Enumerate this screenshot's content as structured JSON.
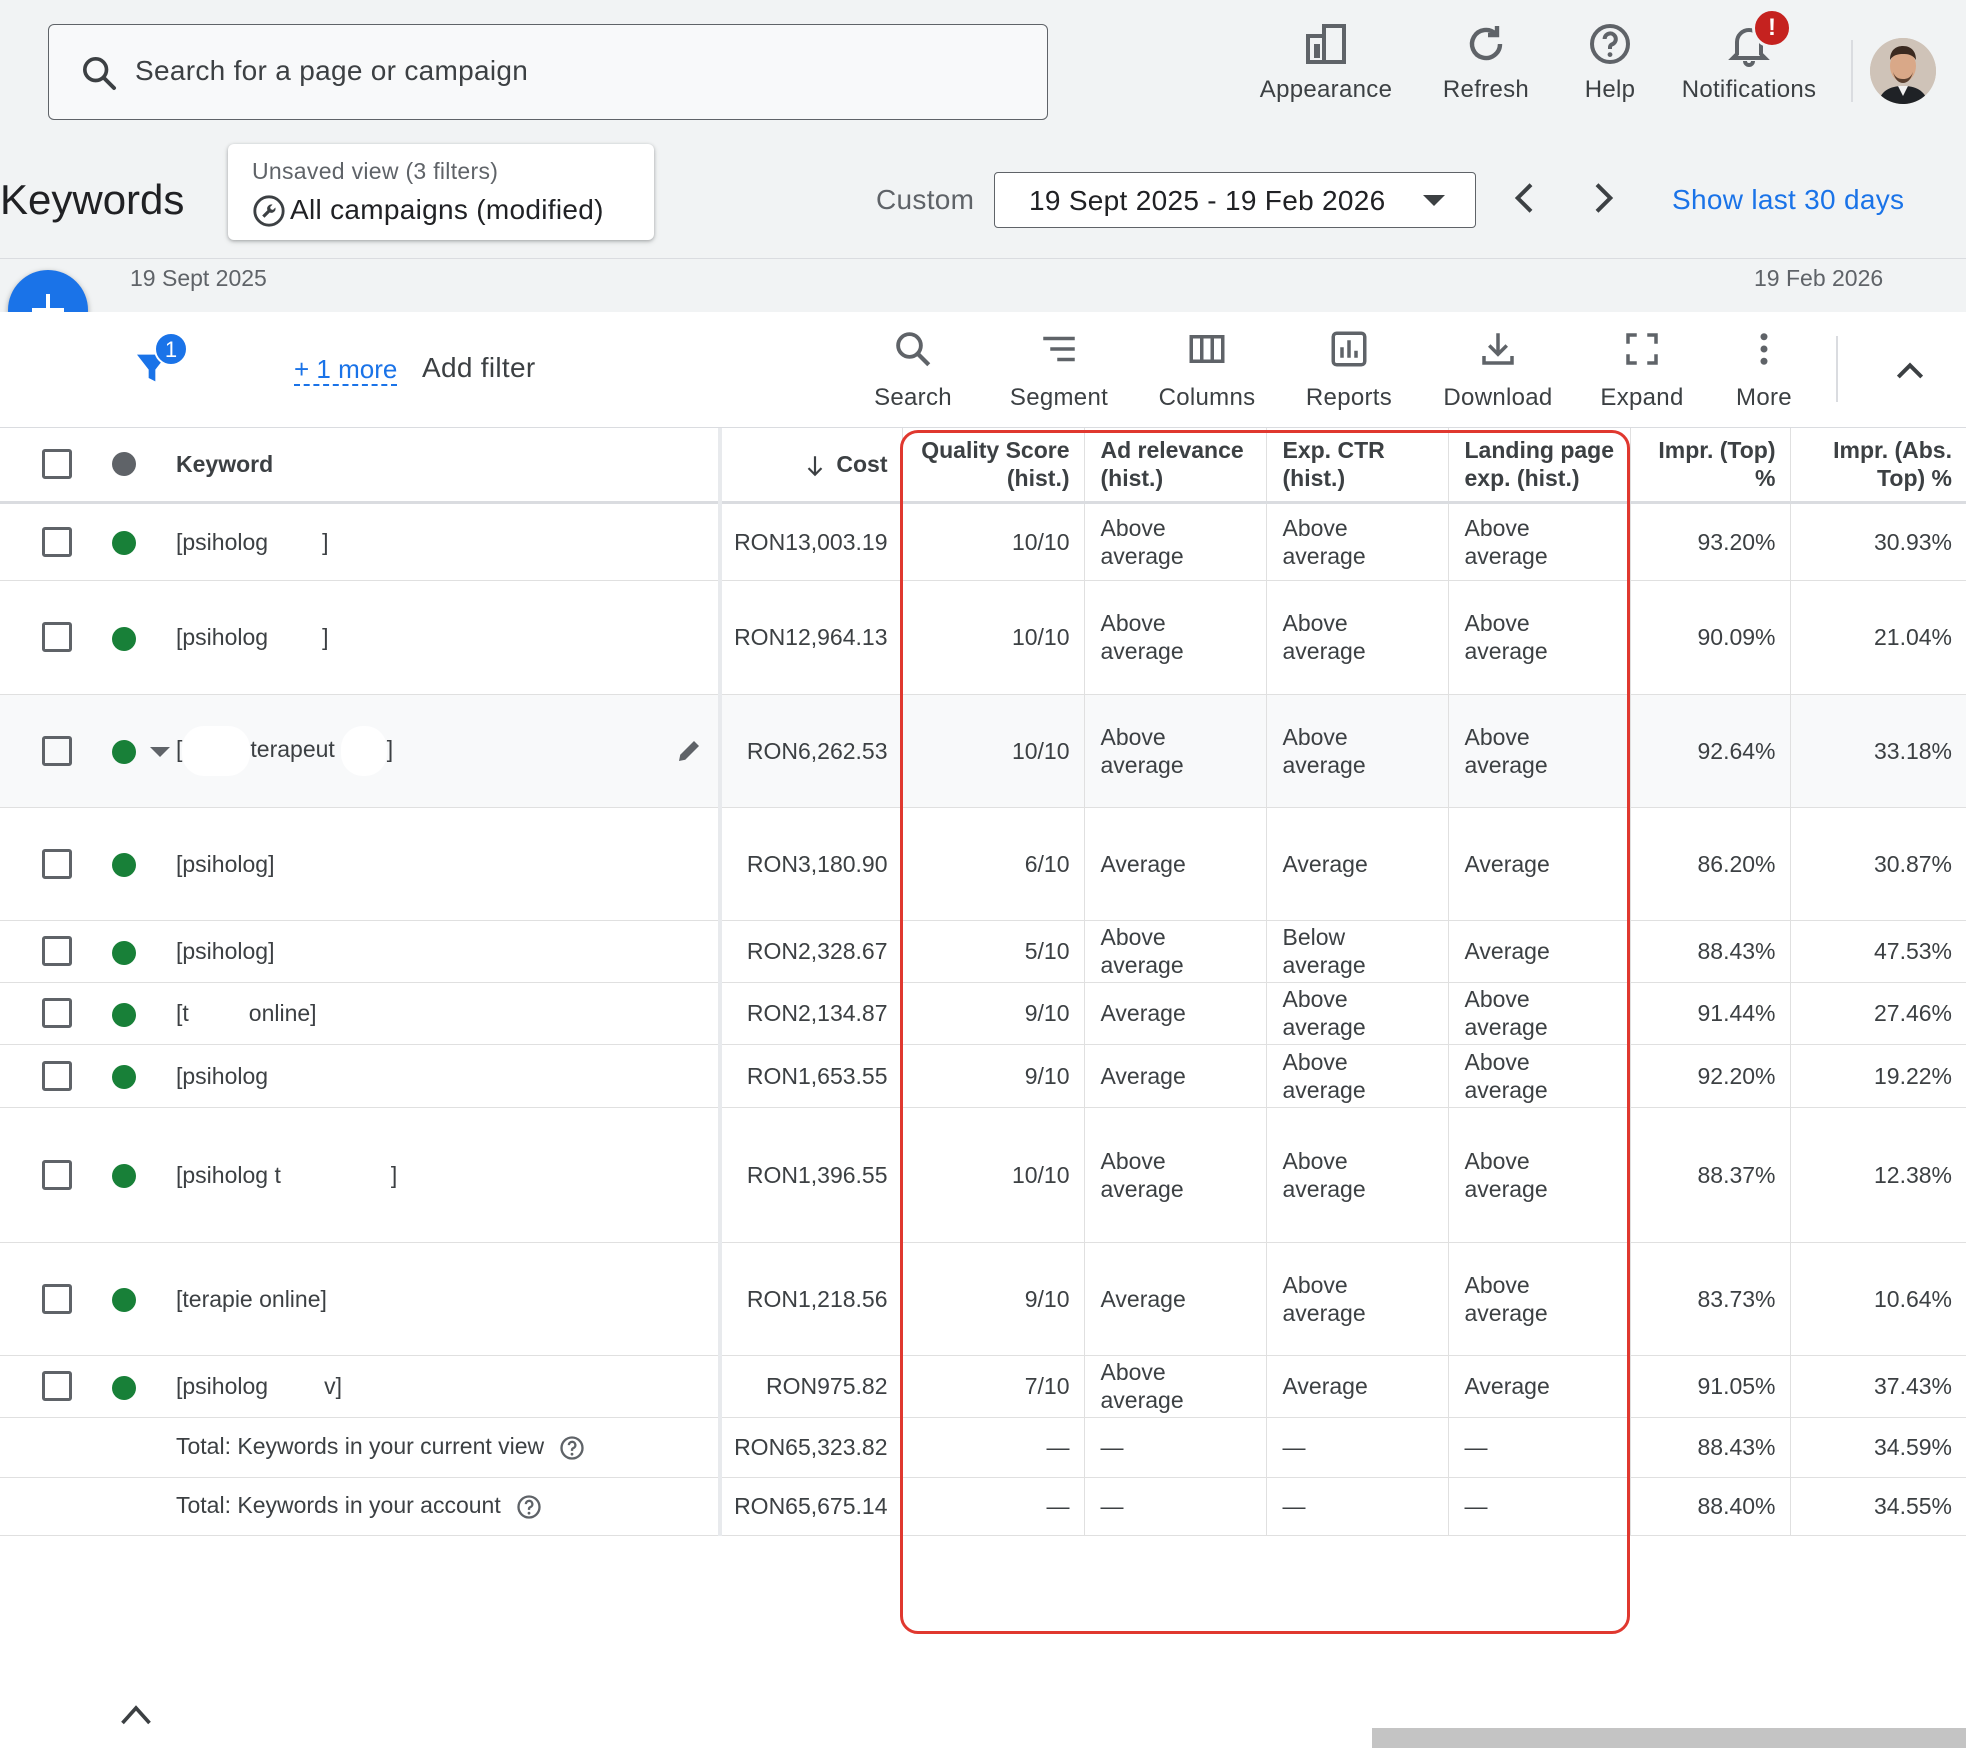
{
  "search": {
    "placeholder": "Search for a page or campaign"
  },
  "topbar": {
    "appearance": "Appearance",
    "refresh": "Refresh",
    "help": "Help",
    "notifications": "Notifications",
    "notification_badge": "!"
  },
  "header": {
    "title": "Keywords",
    "view_sub": "Unsaved view (3 filters)",
    "view_main": "All campaigns (modified)",
    "custom_label": "Custom",
    "date_range": "19 Sept 2025 - 19 Feb 2026",
    "show_last": "Show last 30 days"
  },
  "range": {
    "start": "19 Sept 2025",
    "end": "19 Feb 2026"
  },
  "filters": {
    "badge": "1",
    "more": "+ 1 more",
    "add": "Add filter"
  },
  "toolbar": {
    "search": "Search",
    "segment": "Segment",
    "columns": "Columns",
    "reports": "Reports",
    "download": "Download",
    "expand": "Expand",
    "more": "More"
  },
  "table": {
    "headers": {
      "keyword": "Keyword",
      "cost": "Cost",
      "qs_1": "Quality Score",
      "qs_2": "(hist.)",
      "ar_1": "Ad relevance",
      "ar_2": "(hist.)",
      "ctr_1": "Exp. CTR",
      "ctr_2": "(hist.)",
      "lp_1": "Landing page",
      "lp_2": "exp. (hist.)",
      "top_1": "Impr. (Top)",
      "top_2": "%",
      "abs_1": "Impr. (Abs.",
      "abs_2": "Top) %"
    },
    "rows": [
      {
        "kw_a": "[psiholog",
        "kw_b": "]",
        "cost": "RON13,003.19",
        "qs": "10/10",
        "ar_1": "Above",
        "ar_2": "average",
        "ctr_1": "Above",
        "ctr_2": "average",
        "lp_1": "Above",
        "lp_2": "average",
        "top": "93.20%",
        "abs": "30.93%"
      },
      {
        "kw_a": "[psiholog",
        "kw_b": "]",
        "cost": "RON12,964.13",
        "qs": "10/10",
        "ar_1": "Above",
        "ar_2": "average",
        "ctr_1": "Above",
        "ctr_2": "average",
        "lp_1": "Above",
        "lp_2": "average",
        "top": "90.09%",
        "abs": "21.04%"
      },
      {
        "kw_a": "[",
        "kw_m": "terapeut",
        "kw_b": "]",
        "cost": "RON6,262.53",
        "qs": "10/10",
        "ar_1": "Above",
        "ar_2": "average",
        "ctr_1": "Above",
        "ctr_2": "average",
        "lp_1": "Above",
        "lp_2": "average",
        "top": "92.64%",
        "abs": "33.18%"
      },
      {
        "kw_a": "[psiholog]",
        "cost": "RON3,180.90",
        "qs": "6/10",
        "ar_1": "Average",
        "ctr_1": "Average",
        "lp_1": "Average",
        "top": "86.20%",
        "abs": "30.87%"
      },
      {
        "kw_a": "[psiholog]",
        "cost": "RON2,328.67",
        "qs": "5/10",
        "ar_1": "Above",
        "ar_2": "average",
        "ctr_1": "Below",
        "ctr_2": "average",
        "lp_1": "Average",
        "top": "88.43%",
        "abs": "47.53%"
      },
      {
        "kw_a": "[t",
        "kw_b": "online]",
        "cost": "RON2,134.87",
        "qs": "9/10",
        "ar_1": "Average",
        "ctr_1": "Above",
        "ctr_2": "average",
        "lp_1": "Above",
        "lp_2": "average",
        "top": "91.44%",
        "abs": "27.46%"
      },
      {
        "kw_a": "[psiholog",
        "cost": "RON1,653.55",
        "qs": "9/10",
        "ar_1": "Average",
        "ctr_1": "Above",
        "ctr_2": "average",
        "lp_1": "Above",
        "lp_2": "average",
        "top": "92.20%",
        "abs": "19.22%"
      },
      {
        "kw_a": "[psiholog t",
        "kw_b": "]",
        "cost": "RON1,396.55",
        "qs": "10/10",
        "ar_1": "Above",
        "ar_2": "average",
        "ctr_1": "Above",
        "ctr_2": "average",
        "lp_1": "Above",
        "lp_2": "average",
        "top": "88.37%",
        "abs": "12.38%"
      },
      {
        "kw_a": "[terapie online]",
        "cost": "RON1,218.56",
        "qs": "9/10",
        "ar_1": "Average",
        "ctr_1": "Above",
        "ctr_2": "average",
        "lp_1": "Above",
        "lp_2": "average",
        "top": "83.73%",
        "abs": "10.64%"
      },
      {
        "kw_a": "[psiholog",
        "kw_b": "v]",
        "cost": "RON975.82",
        "qs": "7/10",
        "ar_1": "Above",
        "ar_2": "average",
        "ctr_1": "Average",
        "lp_1": "Average",
        "top": "91.05%",
        "abs": "37.43%"
      }
    ],
    "totals": [
      {
        "label": "Total: Keywords in your current view",
        "cost": "RON65,323.82",
        "qs": "—",
        "ar": "—",
        "ctr": "—",
        "lp": "—",
        "top": "88.43%",
        "abs": "34.59%"
      },
      {
        "label": "Total: Keywords in your account",
        "cost": "RON65,675.14",
        "qs": "—",
        "ar": "—",
        "ctr": "—",
        "lp": "—",
        "top": "88.40%",
        "abs": "34.55%"
      }
    ]
  },
  "colors": {
    "accent": "#1a73e8",
    "enabled": "#188038",
    "highlight_box": "#e0382f",
    "badge": "#c5221f"
  }
}
